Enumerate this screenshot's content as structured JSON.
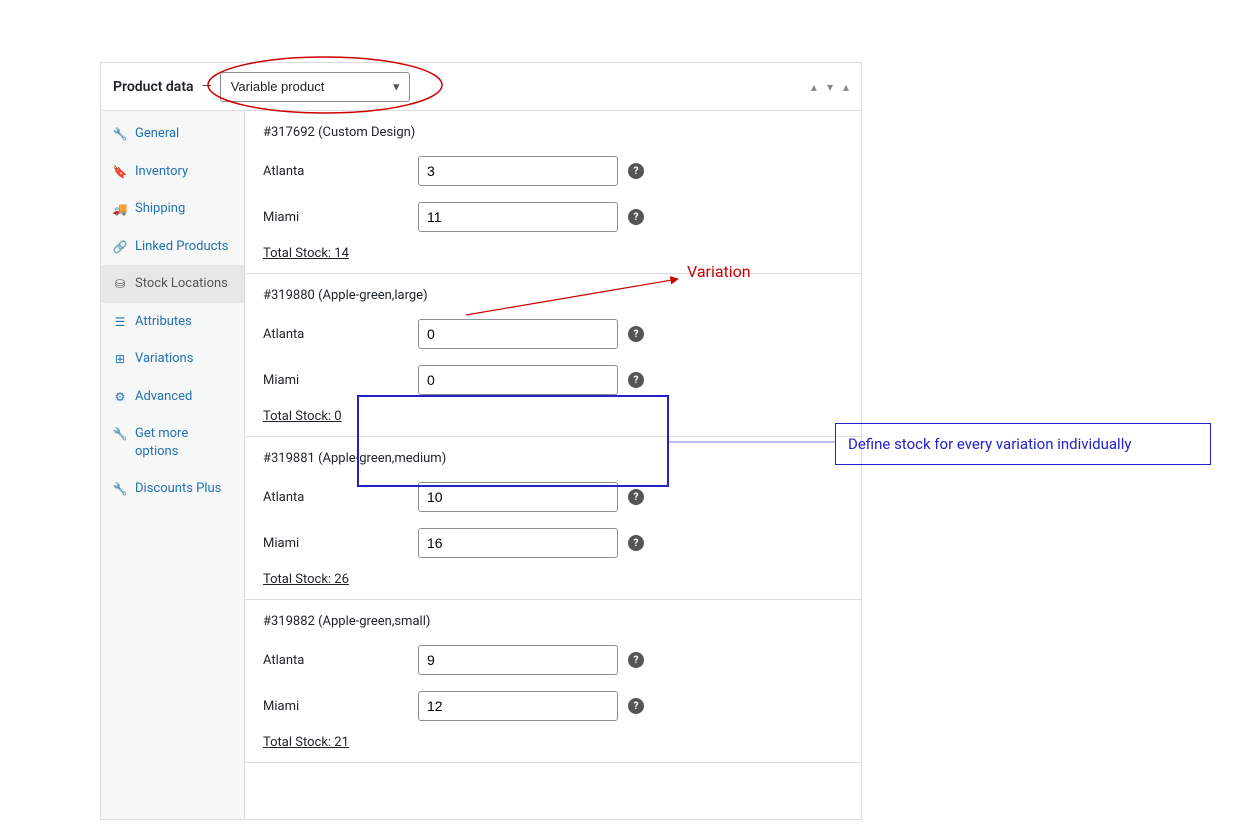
{
  "panel": {
    "title": "Product data",
    "dash": "—",
    "product_type_select": "Variable product"
  },
  "tabs": [
    {
      "icon": "wrench-icon",
      "glyph": "🔧",
      "label": "General"
    },
    {
      "icon": "tag-icon",
      "glyph": "🔖",
      "label": "Inventory"
    },
    {
      "icon": "truck-icon",
      "glyph": "🚚",
      "label": "Shipping"
    },
    {
      "icon": "link-icon",
      "glyph": "🔗",
      "label": "Linked Products"
    },
    {
      "icon": "sitemap-icon",
      "glyph": "⛁",
      "label": "Stock Locations",
      "selected": true
    },
    {
      "icon": "list-icon",
      "glyph": "☰",
      "label": "Attributes"
    },
    {
      "icon": "grid-icon",
      "glyph": "⊞",
      "label": "Variations"
    },
    {
      "icon": "gear-icon",
      "glyph": "⚙",
      "label": "Advanced"
    },
    {
      "icon": "wrench-icon",
      "glyph": "🔧",
      "label": "Get more options"
    },
    {
      "icon": "wrench-icon",
      "glyph": "🔧",
      "label": "Discounts Plus"
    }
  ],
  "variations": [
    {
      "title": "#317692 (Custom Design)",
      "rows": [
        {
          "label": "Atlanta",
          "value": "3"
        },
        {
          "label": "Miami",
          "value": "11"
        }
      ],
      "total": "Total Stock: 14"
    },
    {
      "title": "#319880 (Apple-green,large)",
      "rows": [
        {
          "label": "Atlanta",
          "value": "0"
        },
        {
          "label": "Miami",
          "value": "0"
        }
      ],
      "total": "Total Stock: 0"
    },
    {
      "title": "#319881 (Apple-green,medium)",
      "rows": [
        {
          "label": "Atlanta",
          "value": "10"
        },
        {
          "label": "Miami",
          "value": "16"
        }
      ],
      "total": "Total Stock: 26"
    },
    {
      "title": "#319882 (Apple-green,small)",
      "rows": [
        {
          "label": "Atlanta",
          "value": "9"
        },
        {
          "label": "Miami",
          "value": "12"
        }
      ],
      "total": "Total Stock: 21"
    }
  ],
  "annotations": {
    "variation_label": "Variation",
    "blue_callout": "Define stock for every variation individually"
  }
}
